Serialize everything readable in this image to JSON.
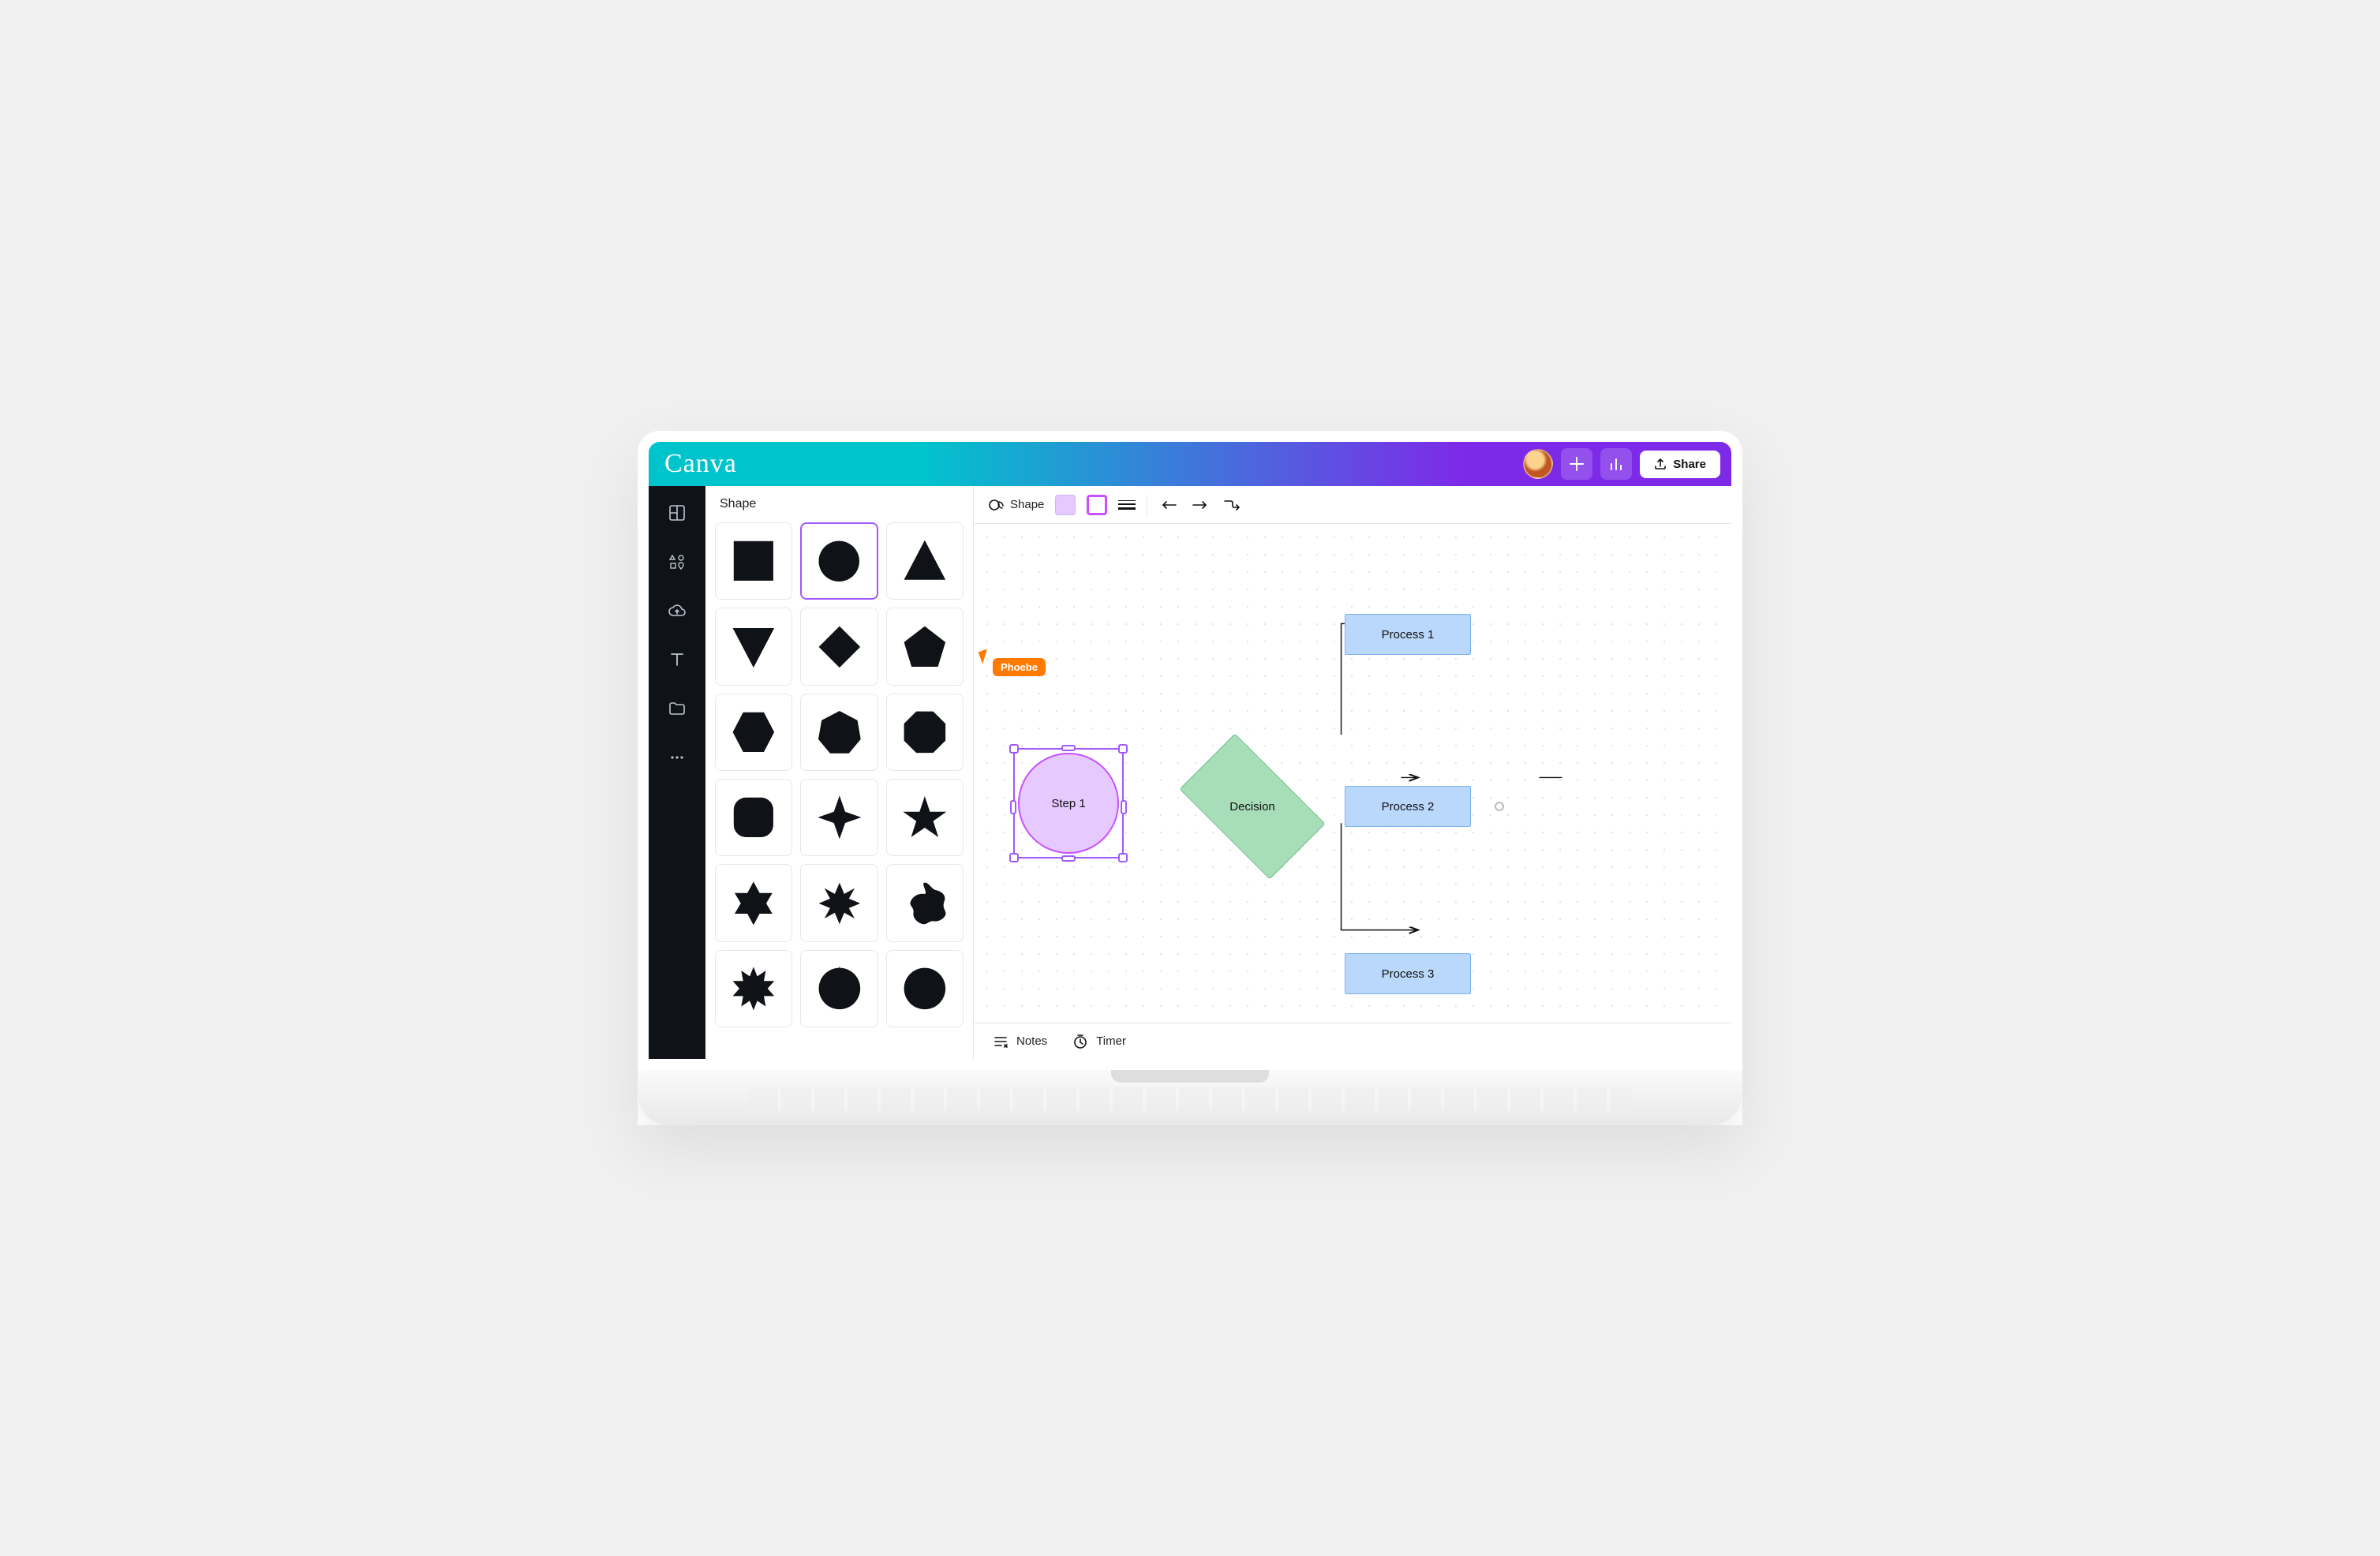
{
  "brand": "Canva",
  "topbar": {
    "share_label": "Share"
  },
  "panel": {
    "title": "Shape",
    "shapes": [
      {
        "name": "square"
      },
      {
        "name": "circle"
      },
      {
        "name": "triangle"
      },
      {
        "name": "triangle-down"
      },
      {
        "name": "diamond"
      },
      {
        "name": "pentagon"
      },
      {
        "name": "hexagon"
      },
      {
        "name": "heptagon"
      },
      {
        "name": "octagon"
      },
      {
        "name": "rounded-octagon"
      },
      {
        "name": "4-point-star"
      },
      {
        "name": "5-point-star"
      },
      {
        "name": "6-point-star"
      },
      {
        "name": "8-point-star"
      },
      {
        "name": "blob-star"
      },
      {
        "name": "burst-12"
      },
      {
        "name": "burst-16"
      },
      {
        "name": "burst-20"
      }
    ]
  },
  "context_toolbar": {
    "shape_label": "Shape",
    "colors": {
      "fill": "#e6c9ff",
      "border": "#c850ff"
    }
  },
  "collaborator": {
    "name": "Phoebe",
    "color": "#ff7a00"
  },
  "diagram": {
    "step1": "Step 1",
    "decision": "Decision",
    "process1": "Process 1",
    "process2": "Process 2",
    "process3": "Process 3"
  },
  "footer": {
    "notes_label": "Notes",
    "timer_label": "Timer"
  }
}
